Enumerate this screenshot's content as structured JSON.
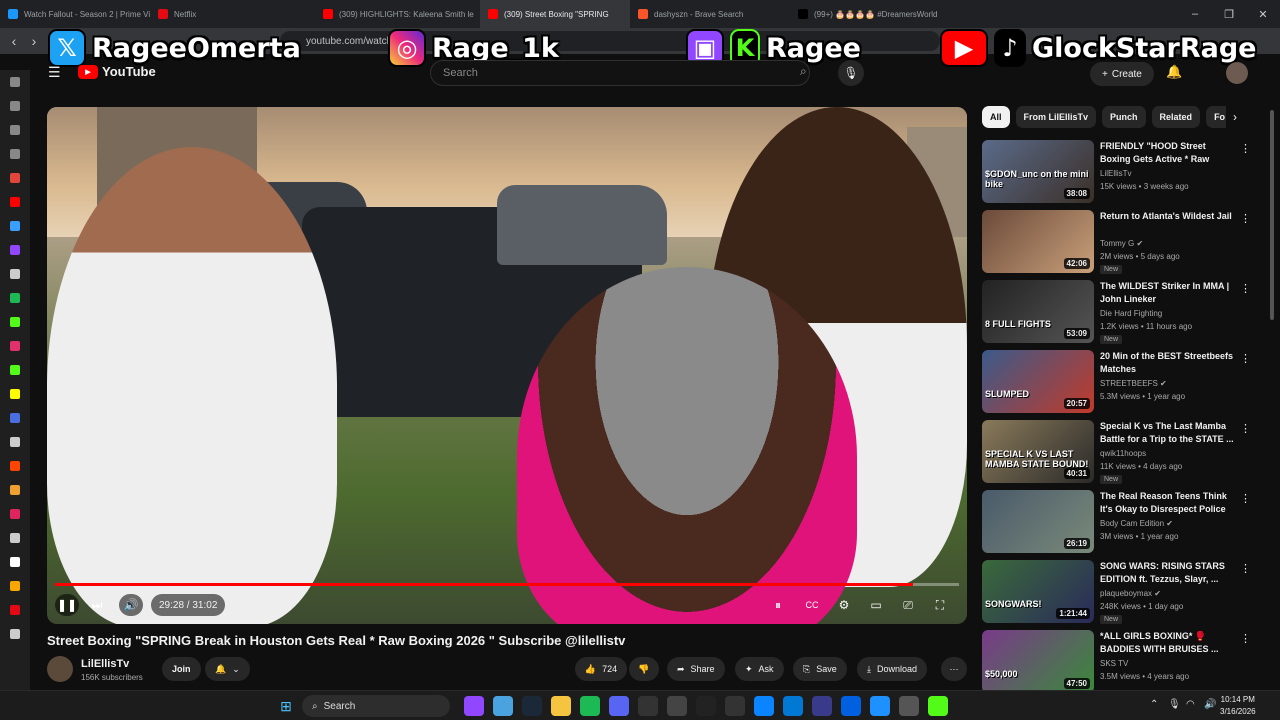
{
  "browser": {
    "tabs": [
      {
        "label": "Watch Fallout - Season 2 | Prime Vid",
        "color": "#1a98ff",
        "active": false
      },
      {
        "label": "Netflix",
        "color": "#e50914",
        "active": false
      },
      {
        "label": "(309) HIGHLIGHTS: Kaleena Smith le",
        "color": "#ff0000",
        "active": false
      },
      {
        "label": "(309) Street Boxing \"SPRING",
        "color": "#ff0000",
        "active": true
      },
      {
        "label": "dashyszn - Brave Search",
        "color": "#fb542b",
        "active": false
      },
      {
        "label": "(99+) 🎂🎂🎂🎂 #DreamersWorld",
        "color": "#000000",
        "active": false
      }
    ],
    "url": "youtube.com/watch",
    "window_buttons": [
      "–",
      "❐",
      "✕"
    ]
  },
  "overlay": {
    "x_handle": "RageeOmerta",
    "instagram_handle": "Rage_1k",
    "twitch_handle": "Ragee",
    "youtube_tiktok_handle": "GlockStarRage"
  },
  "youtube": {
    "logo": "YouTube",
    "search_placeholder": "Search",
    "create_label": "Create"
  },
  "player": {
    "current_time": "29:28",
    "duration": "31:02",
    "time_label": "29:28 / 31:02",
    "progress": 0.949
  },
  "video": {
    "title": "Street Boxing \"SPRING Break in Houston Gets Real * Raw Boxing 2026 \" Subscribe @lilellistv",
    "channel": "LilEllisTv",
    "subscribers": "156K subscribers",
    "join_label": "Join",
    "likes": "724",
    "share_label": "Share",
    "ask_label": "Ask",
    "save_label": "Save",
    "download_label": "Download"
  },
  "chips": [
    "All",
    "From LilEllisTv",
    "Punch",
    "Related",
    "Fo"
  ],
  "recommendations": [
    {
      "title": "FRIENDLY \"HOOD Street Boxing Gets Active * Raw Content \" ...",
      "channel": "LilEllisTv",
      "meta": "15K views • 3 weeks ago",
      "duration": "38:08",
      "new": "",
      "thumb_text": "$GDON_unc on the mini bike",
      "verified": false,
      "color1": "#5b6b8a",
      "color2": "#3a2f28"
    },
    {
      "title": "Return to Atlanta's Wildest Jail",
      "channel": "Tommy G",
      "meta": "2M views • 5 days ago",
      "duration": "42:06",
      "new": "New",
      "thumb_text": "",
      "verified": true,
      "color1": "#6b4a3a",
      "color2": "#c9a07a"
    },
    {
      "title": "The WILDEST Striker In MMA | John Lineker",
      "channel": "Die Hard Fighting",
      "meta": "1.2K views • 11 hours ago",
      "duration": "53:09",
      "new": "New",
      "thumb_text": "8 FULL FIGHTS",
      "verified": false,
      "color1": "#222222",
      "color2": "#555555"
    },
    {
      "title": "20 Min of the BEST Streetbeefs Matches",
      "channel": "STREETBEEFS",
      "meta": "5.3M views • 1 year ago",
      "duration": "20:57",
      "new": "",
      "thumb_text": "SLUMPED",
      "verified": true,
      "color1": "#3a5a8a",
      "color2": "#c23a2a"
    },
    {
      "title": "Special K vs The Last Mamba Battle for a Trip to the STATE ...",
      "channel": "qwik11hoops",
      "meta": "11K views • 4 days ago",
      "duration": "40:31",
      "new": "New",
      "thumb_text": "SPECIAL K VS LAST MAMBA STATE BOUND!",
      "verified": false,
      "color1": "#8a7a5a",
      "color2": "#2a2a2a"
    },
    {
      "title": "The Real Reason Teens Think It's Okay to Disrespect Police",
      "channel": "Body Cam Edition",
      "meta": "3M views • 1 year ago",
      "duration": "26:19",
      "new": "",
      "thumb_text": "",
      "verified": true,
      "color1": "#4a5a6a",
      "color2": "#7a8a7a"
    },
    {
      "title": "SONG WARS: RISING STARS EDITION ft. Tezzus, Slayr, ...",
      "channel": "plaqueboymax",
      "meta": "248K views • 1 day ago",
      "duration": "1:21:44",
      "new": "New",
      "thumb_text": "SONGWARS!",
      "verified": true,
      "color1": "#3a6a3a",
      "color2": "#2a2a5a"
    },
    {
      "title": "*ALL GIRLS BOXING* 🥊 BADDIES WITH BRUISES ...",
      "channel": "SKS TV",
      "meta": "3.5M views • 4 years ago",
      "duration": "47:50",
      "new": "",
      "thumb_text": "$50,000",
      "verified": false,
      "color1": "#7a3a8a",
      "color2": "#3a8a3a"
    }
  ],
  "taskbar": {
    "search_label": "Search",
    "time": "10:14 PM",
    "date": "3/16/2026"
  }
}
